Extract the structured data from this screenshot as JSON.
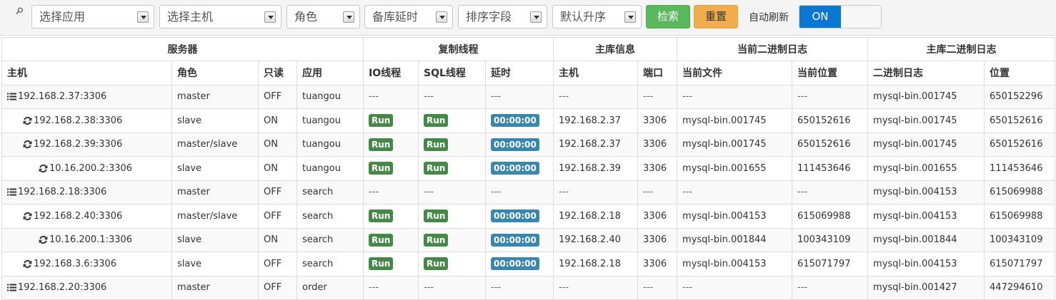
{
  "filters": {
    "app_placeholder": "选择应用",
    "host_placeholder": "选择主机",
    "role_placeholder": "角色",
    "delay_placeholder": "备库延时",
    "sort_field_placeholder": "排序字段",
    "sort_order_placeholder": "默认升序",
    "search_label": "检索",
    "reset_label": "重置",
    "auto_refresh_label": "自动刷新",
    "toggle_on_label": "ON"
  },
  "table": {
    "groups": [
      "服务器",
      "复制线程",
      "主库信息",
      "当前二进制日志",
      "主库二进制日志"
    ],
    "columns": [
      "主机",
      "角色",
      "只读",
      "应用",
      "IO线程",
      "SQL线程",
      "延时",
      "主机",
      "端口",
      "当前文件",
      "当前位置",
      "二进制日志",
      "位置"
    ],
    "rows": [
      {
        "level": 0,
        "icon": "list-icon",
        "host": "192.168.2.37:3306",
        "role": "master",
        "readonly": "OFF",
        "app": "tuangou",
        "io": "---",
        "sql": "---",
        "delay": "---",
        "master_host": "---",
        "master_port": "---",
        "cur_file": "---",
        "cur_pos": "---",
        "bin_log": "mysql-bin.001745",
        "bin_pos": "650152296"
      },
      {
        "level": 1,
        "icon": "refresh-icon",
        "host": "192.168.2.38:3306",
        "role": "slave",
        "readonly": "ON",
        "app": "tuangou",
        "io": "Run",
        "sql": "Run",
        "delay": "00:00:00",
        "master_host": "192.168.2.37",
        "master_port": "3306",
        "cur_file": "mysql-bin.001745",
        "cur_pos": "650152616",
        "bin_log": "mysql-bin.001745",
        "bin_pos": "650152616"
      },
      {
        "level": 1,
        "icon": "refresh-icon",
        "host": "192.168.2.39:3306",
        "role": "master/slave",
        "readonly": "ON",
        "app": "tuangou",
        "io": "Run",
        "sql": "Run",
        "delay": "00:00:00",
        "master_host": "192.168.2.37",
        "master_port": "3306",
        "cur_file": "mysql-bin.001745",
        "cur_pos": "650152616",
        "bin_log": "mysql-bin.001745",
        "bin_pos": "650152616"
      },
      {
        "level": 2,
        "icon": "refresh-icon",
        "host": "10.16.200.2:3306",
        "role": "slave",
        "readonly": "ON",
        "app": "tuangou",
        "io": "Run",
        "sql": "Run",
        "delay": "00:00:00",
        "master_host": "192.168.2.39",
        "master_port": "3306",
        "cur_file": "mysql-bin.001655",
        "cur_pos": "111453646",
        "bin_log": "mysql-bin.001655",
        "bin_pos": "111453646"
      },
      {
        "level": 0,
        "icon": "list-icon",
        "host": "192.168.2.18:3306",
        "role": "master",
        "readonly": "OFF",
        "app": "search",
        "io": "---",
        "sql": "---",
        "delay": "---",
        "master_host": "---",
        "master_port": "---",
        "cur_file": "---",
        "cur_pos": "---",
        "bin_log": "mysql-bin.004153",
        "bin_pos": "615069988"
      },
      {
        "level": 1,
        "icon": "refresh-icon",
        "host": "192.168.2.40:3306",
        "role": "master/slave",
        "readonly": "OFF",
        "app": "search",
        "io": "Run",
        "sql": "Run",
        "delay": "00:00:00",
        "master_host": "192.168.2.18",
        "master_port": "3306",
        "cur_file": "mysql-bin.004153",
        "cur_pos": "615069988",
        "bin_log": "mysql-bin.004153",
        "bin_pos": "615069988"
      },
      {
        "level": 2,
        "icon": "refresh-icon",
        "host": "10.16.200.1:3306",
        "role": "slave",
        "readonly": "ON",
        "app": "search",
        "io": "Run",
        "sql": "Run",
        "delay": "00:00:00",
        "master_host": "192.168.2.40",
        "master_port": "3306",
        "cur_file": "mysql-bin.001844",
        "cur_pos": "100343109",
        "bin_log": "mysql-bin.001844",
        "bin_pos": "100343109"
      },
      {
        "level": 1,
        "icon": "refresh-icon",
        "host": "192.168.3.6:3306",
        "role": "slave",
        "readonly": "OFF",
        "app": "search",
        "io": "Run",
        "sql": "Run",
        "delay": "00:00:00",
        "master_host": "192.168.2.18",
        "master_port": "3306",
        "cur_file": "mysql-bin.004153",
        "cur_pos": "615071797",
        "bin_log": "mysql-bin.004153",
        "bin_pos": "615071797"
      },
      {
        "level": 0,
        "icon": "list-icon",
        "host": "192.168.2.20:3306",
        "role": "master",
        "readonly": "OFF",
        "app": "order",
        "io": "---",
        "sql": "---",
        "delay": "---",
        "master_host": "---",
        "master_port": "---",
        "cur_file": "---",
        "cur_pos": "---",
        "bin_log": "mysql-bin.001427",
        "bin_pos": "447294610"
      }
    ]
  },
  "colors": {
    "run_label": "#468847",
    "delay_label": "#3a87ad",
    "search_button": "#5cb85c",
    "reset_button": "#f0ad4e",
    "toggle_on": "#0a78d1"
  }
}
